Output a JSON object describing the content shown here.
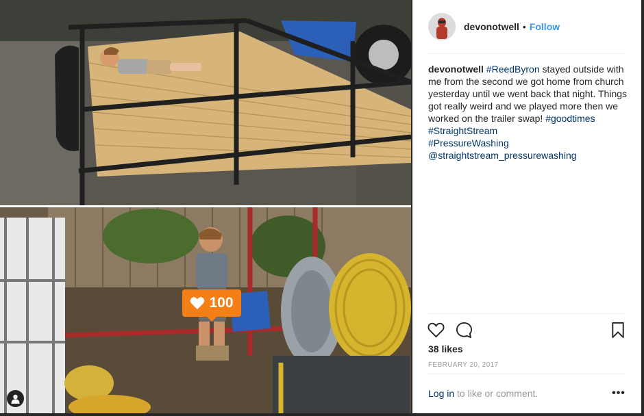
{
  "photo": {
    "likes_badge_count": "100"
  },
  "post": {
    "username": "devonotwell",
    "separator": "•",
    "follow_label": "Follow",
    "caption": {
      "username": "devonotwell",
      "mention_tag": "#ReedByron",
      "text": " stayed outside with me from the second we got home from church yesterday until we went back that night. Things got really weird and we played more then we worked on the trailer swap! ",
      "tags": [
        "#goodtimes",
        "#StraightStream",
        "#PressureWashing",
        "@straightstream_pressurewashing"
      ]
    },
    "likes_label": "38 likes",
    "date": "FEBRUARY 20, 2017",
    "login_link": "Log in",
    "login_rest": " to like or comment.",
    "more_label": "•••"
  },
  "icons": {
    "like": "heart-icon",
    "comment": "comment-icon",
    "save": "bookmark-icon",
    "more": "more-options-icon",
    "tag": "user-tag-icon"
  },
  "colors": {
    "accent_link": "#3897f0",
    "hashtag": "#003569",
    "badge": "#f57f17"
  }
}
